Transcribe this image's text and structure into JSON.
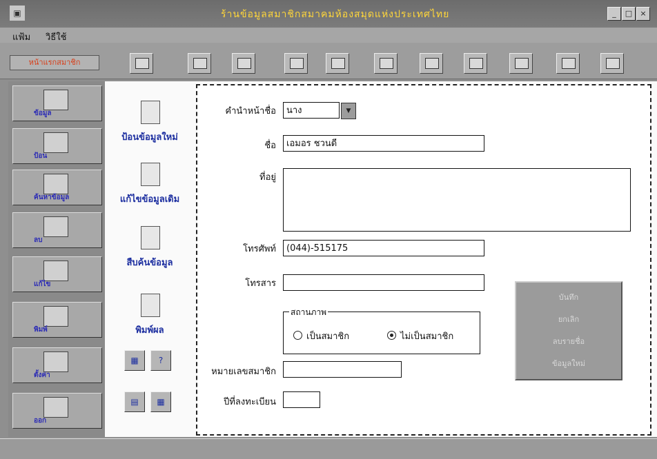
{
  "window": {
    "title": "ร้านข้อมูลสมาชิกสมาคมห้องสมุดแห่งประเทศไทย",
    "icon": "app-icon",
    "controls": [
      "_",
      "□",
      "×"
    ]
  },
  "menu": {
    "items": [
      "แฟ้ม",
      "วิธีใช้"
    ]
  },
  "toolbar": {
    "dropdown_label": "หน้าแรกสมาชิก"
  },
  "sidebar": {
    "items": [
      "ข้อมูล",
      "ป้อน",
      "ค้นหาข้อมูล",
      "ลบ",
      "แก้ไข",
      "พิมพ์",
      "ตั้งค่า",
      "ออก"
    ]
  },
  "actions": {
    "new": "ป้อนข้อมูลใหม่",
    "edit": "แก้ไขข้อมูลเดิม",
    "search": "สืบค้นข้อมูล",
    "print": "พิมพ์ผล"
  },
  "form": {
    "prefix_label": "คำนำหน้าชื่อ",
    "prefix_value": "นาง",
    "name_label": "ชื่อ",
    "name_value": "เอมอร ชวนดี",
    "address_label": "ที่อยู่",
    "address_value": "",
    "phone_label": "โทรศัพท์",
    "phone_value": "(044)-515175",
    "fax_label": "โทรสาร",
    "fax_value": "",
    "status_title": "สถานภาพ",
    "status_member": "เป็นสมาชิก",
    "status_nonmember": "ไม่เป็นสมาชิก",
    "status_selected": "ไม่เป็นสมาชิก",
    "member_no_label": "หมายเลขสมาชิก",
    "member_no_value": "",
    "reg_year_label": "ปีที่ลงทะเบียน",
    "reg_year_value": ""
  },
  "commands": [
    "บันทึก",
    "ยกเลิก",
    "ลบรายชื่อ",
    "ข้อมูลใหม่"
  ]
}
